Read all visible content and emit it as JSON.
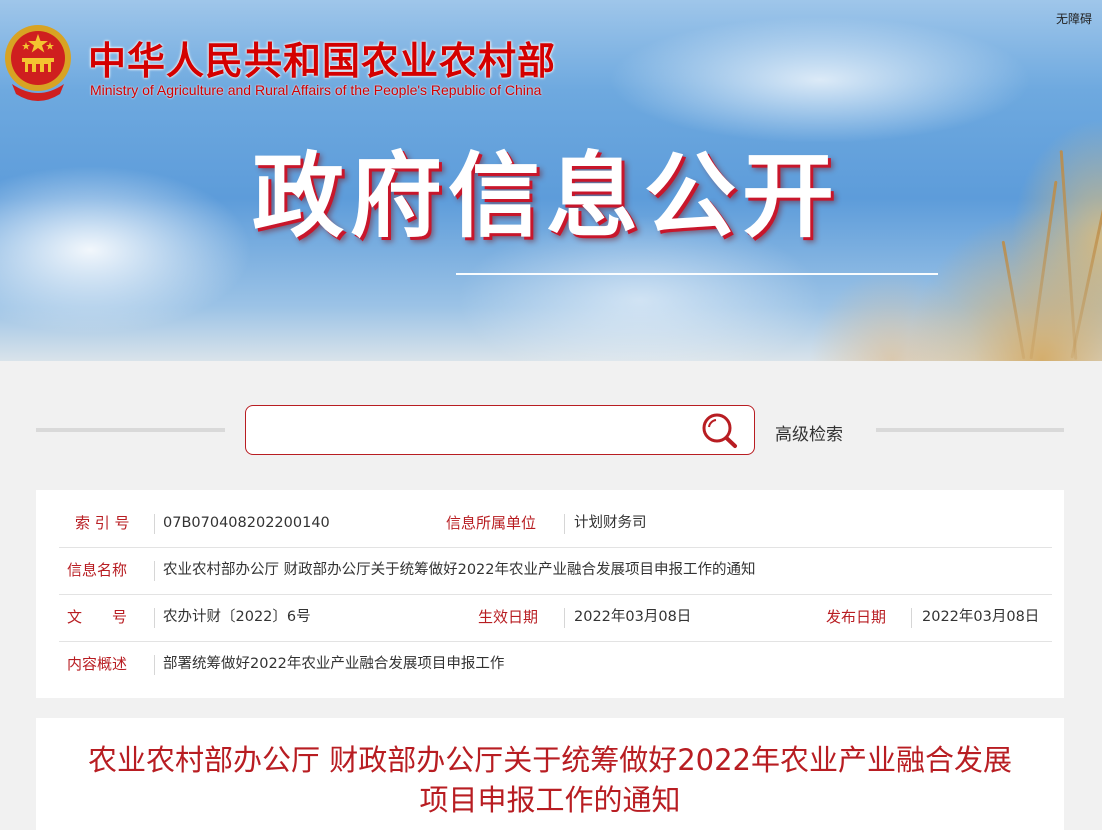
{
  "header": {
    "accessibility_label": "无障碍",
    "logo_cn": "中华人民共和国农业农村部",
    "logo_en": "Ministry of Agriculture and Rural Affairs of the People's Republic of China",
    "banner_title": "政府信息公开"
  },
  "search": {
    "placeholder": "",
    "advanced_label": "高级检索"
  },
  "meta": {
    "index_label": "索 引 号",
    "index_value": "07B070408202200140",
    "unit_label": "信息所属单位",
    "unit_value": "计划财务司",
    "name_label": "信息名称",
    "name_value": "农业农村部办公厅 财政部办公厅关于统筹做好2022年农业产业融合发展项目申报工作的通知",
    "doc_label": "文　　号",
    "doc_value": "农办计财〔2022〕6号",
    "effective_label": "生效日期",
    "effective_value": "2022年03月08日",
    "publish_label": "发布日期",
    "publish_value": "2022年03月08日",
    "summary_label": "内容概述",
    "summary_value": "部署统筹做好2022年农业产业融合发展项目申报工作"
  },
  "article": {
    "title": "农业农村部办公厅 财政部办公厅关于统筹做好2022年农业产业融合发展项目申报工作的通知"
  },
  "colors": {
    "accent_red": "#b81d22",
    "logo_red": "#d40000"
  }
}
